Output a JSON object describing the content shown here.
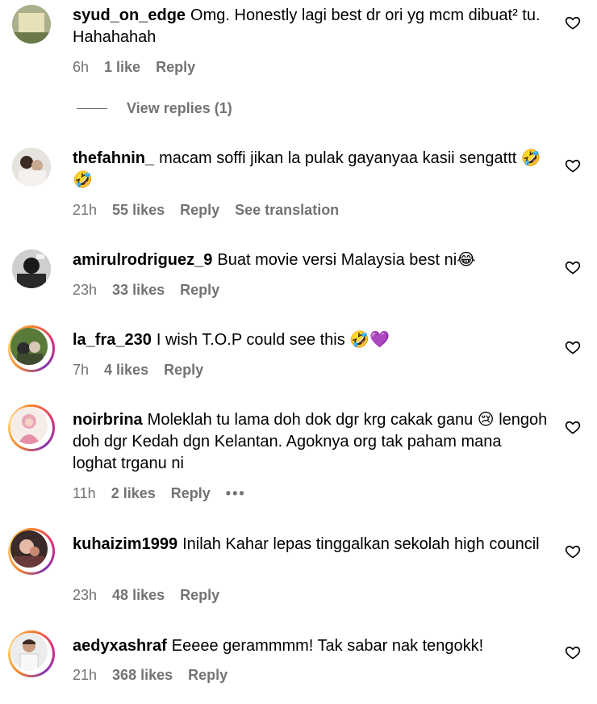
{
  "comments": [
    {
      "username": "syud_on_edge",
      "text": "Omg. Honestly lagi best dr ori yg mcm dibuat² tu. Hahahahah",
      "time": "6h",
      "likes": "1 like",
      "reply": "Reply"
    },
    {
      "username": "thefahnin_",
      "text": "macam soffi jikan la pulak gayanyaa kasii sengattt 🤣🤣",
      "time": "21h",
      "likes": "55 likes",
      "reply": "Reply",
      "translate": "See translation"
    },
    {
      "username": "amirulrodriguez_9",
      "text": "Buat movie versi Malaysia best ni😂",
      "time": "23h",
      "likes": "33 likes",
      "reply": "Reply"
    },
    {
      "username": "la_fra_230",
      "text": "I wish T.O.P could see this 🤣💜",
      "time": "7h",
      "likes": "4 likes",
      "reply": "Reply"
    },
    {
      "username": "noirbrina",
      "text": "Moleklah tu lama doh dok dgr krg cakak ganu 😢 lengoh doh dgr Kedah dgn Kelantan. Agoknya org tak paham mana loghat trganu ni",
      "time": "11h",
      "likes": "2 likes",
      "reply": "Reply",
      "more": "•••"
    },
    {
      "username": "kuhaizim1999",
      "text": "Inilah Kahar lepas tinggalkan sekolah high council",
      "time": "23h",
      "likes": "48 likes",
      "reply": "Reply"
    },
    {
      "username": "aedyxashraf",
      "text": "Eeeee gerammmm! Tak sabar nak tengokk!",
      "time": "21h",
      "likes": "368 likes",
      "reply": "Reply"
    }
  ],
  "view_replies": "View replies (1)"
}
